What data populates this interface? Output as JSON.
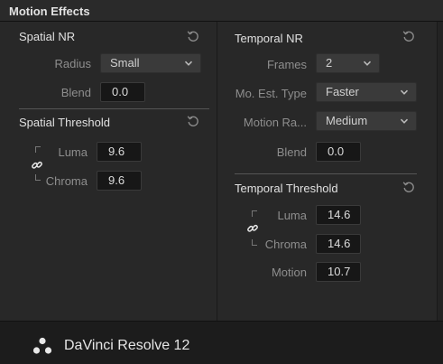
{
  "panel": {
    "title": "Motion Effects"
  },
  "spatial_nr": {
    "title": "Spatial NR",
    "radius_label": "Radius",
    "radius_value": "Small",
    "blend_label": "Blend",
    "blend_value": "0.0"
  },
  "spatial_threshold": {
    "title": "Spatial Threshold",
    "luma_label": "Luma",
    "luma_value": "9.6",
    "chroma_label": "Chroma",
    "chroma_value": "9.6"
  },
  "temporal_nr": {
    "title": "Temporal NR",
    "frames_label": "Frames",
    "frames_value": "2",
    "mo_est_label": "Mo. Est. Type",
    "mo_est_value": "Faster",
    "motion_range_label": "Motion Ra...",
    "motion_range_value": "Medium",
    "blend_label": "Blend",
    "blend_value": "0.0"
  },
  "temporal_threshold": {
    "title": "Temporal Threshold",
    "luma_label": "Luma",
    "luma_value": "14.6",
    "chroma_label": "Chroma",
    "chroma_value": "14.6",
    "motion_label": "Motion",
    "motion_value": "10.7"
  },
  "footer": {
    "brand": "DaVinci Resolve 12"
  },
  "icons": {
    "reset": "reset-icon",
    "link": "link-icon",
    "chevron": "chevron-down-icon",
    "logo": "davinci-logo"
  }
}
